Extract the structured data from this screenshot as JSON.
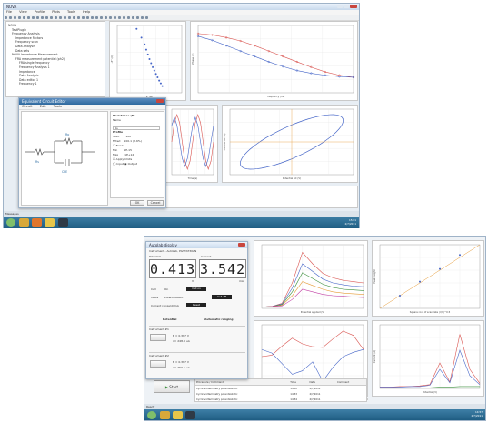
{
  "top_window": {
    "title": "NOVA",
    "menu": [
      "File",
      "View",
      "Profile",
      "Plots",
      "Tools",
      "Help"
    ],
    "tree": [
      "NOVA",
      "TestPlugin",
      "Frequency Analysis",
      "Impedance Factors",
      "Frequency scan",
      "Data Analysis",
      "Data sets",
      "NOVA Impedance Measurement",
      "FRA measurement potential (ph2)",
      "FRA single frequency",
      "Frequency Analysis 1",
      "Impedance",
      "Data Analysis",
      "Data editor 1",
      "Frequency 1"
    ],
    "status_left": "Messages"
  },
  "circuit_editor": {
    "title": "Equivalent Circuit Editor",
    "menu": [
      "Circuit",
      "Edit",
      "Tools"
    ],
    "properties": {
      "title": "Resistance (R)",
      "name_label": "Name",
      "name_value": "Rs",
      "profile_label": "Profile",
      "start_label": "Start",
      "start_value": "100",
      "fitted_label": "Fitted",
      "fitted_value": "100.1 (2.6%)",
      "fixed_label": "Fixed",
      "min_label": "Min",
      "min_value": "1E-15",
      "max_label": "Max",
      "max_value": "1E+12",
      "apply_label": "Apply limits",
      "input_label": "Input",
      "output_label": "Output"
    },
    "elements": [
      "Rs",
      "Rp",
      "CPE",
      "Q"
    ],
    "ok_label": "OK",
    "cancel_label": "Cancel"
  },
  "potentiostat_panel": {
    "title": "Autolab display",
    "subtitle": "Instrument - Autolab, PGSTAT302N",
    "left_label": "Potential",
    "right_label": "Current",
    "left_value": "0.413",
    "right_value": "3.542",
    "left_unit": "V",
    "right_unit": "mA",
    "cell_label": "Cell",
    "cell_value": "On",
    "mode_label": "Mode",
    "mode_value": "Potentiostatic",
    "range_label": "Current range",
    "range_value": "10 mA",
    "buttons": [
      "Cell on",
      "Cell off",
      "Reset"
    ],
    "bottom_left": "Potential",
    "bottom_right": "Automatic ranging",
    "section1": "Instrument #1",
    "section2": "Instrument #2",
    "r1_value": "E = 0.387  V",
    "r1_current": "i = 248.8  uA",
    "r2_value": "E = 0.387  V",
    "r2_current": "i = 250.5  uA"
  },
  "bottom_window": {
    "start_label": "Start",
    "table_headers": [
      "Procedure / Command",
      "Time",
      "Date",
      "Comment"
    ],
    "table_rows": [
      [
        "Cyclic voltammetry potentiostatic",
        "14:52",
        "2/7/2011",
        ""
      ],
      [
        "Cyclic voltammetry potentiostatic",
        "14:53",
        "2/7/2011",
        ""
      ],
      [
        "Cyclic voltammetry potentiostatic",
        "14:54",
        "2/7/2011",
        ""
      ],
      [
        "Cyclic voltammetry potentiostatic",
        "14:55",
        "2/7/2011",
        ""
      ],
      [
        "Cyclic voltammetry potentiostatic",
        "14:56",
        "2/7/2011",
        ""
      ]
    ],
    "status_left": "Ready"
  },
  "taskbar": {
    "clock_top": "15:01",
    "clock_bottom": "2/7/2011",
    "clock2_top": "14:57",
    "clock2_bottom": "2/7/2011"
  },
  "colors": {
    "accent": "#2a6aa0",
    "series_red": "#d9534f",
    "series_blue": "#4666c8",
    "series_green": "#3c8f3c",
    "series_orange": "#e59a35",
    "series_magenta": "#c13fa4"
  },
  "chart_data": [
    {
      "type": "scatter",
      "id": "nyquist",
      "x": [
        52,
        55,
        57,
        58,
        59,
        60,
        61,
        62,
        63,
        64,
        65,
        66,
        67,
        68
      ],
      "y": [
        95,
        82,
        72,
        64,
        57,
        50,
        44,
        38,
        33,
        28,
        23,
        18,
        14,
        10
      ],
      "xlim": [
        40,
        80
      ],
      "ylim": [
        0,
        100
      ],
      "xlabel": "Z' (Ω)",
      "ylabel": "-Z'' (Ω)"
    },
    {
      "type": "line",
      "id": "bode",
      "x": [
        1,
        2,
        3,
        4,
        5,
        6,
        7,
        8,
        9,
        10,
        11,
        12
      ],
      "series": [
        {
          "values": [
            88,
            86,
            82,
            77,
            70,
            62,
            54,
            46,
            38,
            31,
            26,
            23
          ]
        },
        {
          "values": [
            84,
            78,
            70,
            62,
            54,
            46,
            39,
            33,
            29,
            26,
            24,
            23
          ]
        }
      ],
      "ylim": [
        0,
        100
      ],
      "xlabel": "Frequency (Hz)",
      "ylabel": "-Phase (°)"
    },
    {
      "type": "line",
      "id": "sine",
      "x": [
        0,
        1,
        2,
        3,
        4,
        5,
        6,
        7,
        8,
        9,
        10,
        11,
        12,
        13,
        14,
        15,
        16
      ],
      "series": [
        {
          "values": [
            0,
            0.7,
            1,
            0.7,
            0,
            -0.7,
            -1,
            -0.7,
            0,
            0.7,
            1,
            0.7,
            0,
            -0.7,
            -1,
            -0.7,
            0
          ]
        },
        {
          "values": [
            0.6,
            0.9,
            0.6,
            0,
            -0.6,
            -0.9,
            -0.6,
            0,
            0.6,
            0.9,
            0.6,
            0,
            -0.6,
            -0.9,
            -0.6,
            0,
            0.6
          ]
        }
      ],
      "ylim": [
        -1.2,
        1.2
      ],
      "xlabel": "Time (s)"
    },
    {
      "type": "line",
      "id": "lissajous",
      "ylim": [
        -1.2,
        1.2
      ],
      "xlim": [
        -1.2,
        1.2
      ],
      "xlabel": "Potential AC (V)",
      "ylabel": "Current AC (A)"
    },
    {
      "type": "line",
      "id": "peaks",
      "x": [
        0,
        1,
        2,
        3,
        4,
        5,
        6,
        7,
        8,
        9,
        10
      ],
      "series": [
        {
          "values": [
            2,
            3,
            8,
            40,
            88,
            70,
            55,
            48,
            44,
            42,
            40
          ]
        },
        {
          "values": [
            2,
            3,
            7,
            32,
            70,
            58,
            46,
            40,
            37,
            35,
            34
          ]
        },
        {
          "values": [
            2,
            3,
            6,
            26,
            56,
            47,
            38,
            33,
            30,
            29,
            28
          ]
        },
        {
          "values": [
            2,
            3,
            5,
            20,
            42,
            36,
            30,
            26,
            24,
            23,
            22
          ]
        },
        {
          "values": [
            2,
            3,
            4,
            14,
            30,
            26,
            22,
            20,
            19,
            18,
            17
          ]
        }
      ],
      "ylim": [
        0,
        100
      ],
      "xlabel": "Potential applied (V)"
    },
    {
      "type": "scatter",
      "id": "linear",
      "x": [
        0.1,
        0.15,
        0.2,
        0.25
      ],
      "y": [
        20,
        42,
        62,
        84
      ],
      "xlim": [
        0.05,
        0.3
      ],
      "ylim": [
        0,
        100
      ],
      "xlabel": "Square root of scan rate (V/s)^0.5",
      "ylabel": "Peak height"
    },
    {
      "type": "line",
      "id": "cv",
      "x": [
        0,
        1,
        2,
        3,
        4,
        5,
        6,
        7,
        8,
        9,
        10
      ],
      "series": [
        {
          "values": [
            10,
            14,
            40,
            62,
            46,
            38,
            36,
            60,
            82,
            70,
            30
          ]
        },
        {
          "values": [
            30,
            20,
            -10,
            -40,
            -30,
            -5,
            -60,
            -20,
            10,
            22,
            30
          ]
        }
      ],
      "ylim": [
        -80,
        100
      ],
      "xlabel": "Potential (V)"
    },
    {
      "type": "line",
      "id": "dpv",
      "x": [
        0,
        1,
        2,
        3,
        4,
        5,
        6,
        7,
        8,
        9,
        10
      ],
      "series": [
        {
          "values": [
            2,
            2,
            3,
            3,
            4,
            6,
            40,
            10,
            85,
            30,
            8
          ]
        },
        {
          "values": [
            2,
            2,
            2,
            3,
            3,
            5,
            30,
            9,
            60,
            20,
            6
          ]
        },
        {
          "values": [
            1,
            1,
            1,
            1,
            1,
            1,
            2,
            2,
            3,
            3,
            3
          ]
        }
      ],
      "ylim": [
        0,
        100
      ],
      "xlabel": "Potential (V)",
      "ylabel": "Current (A)"
    }
  ]
}
